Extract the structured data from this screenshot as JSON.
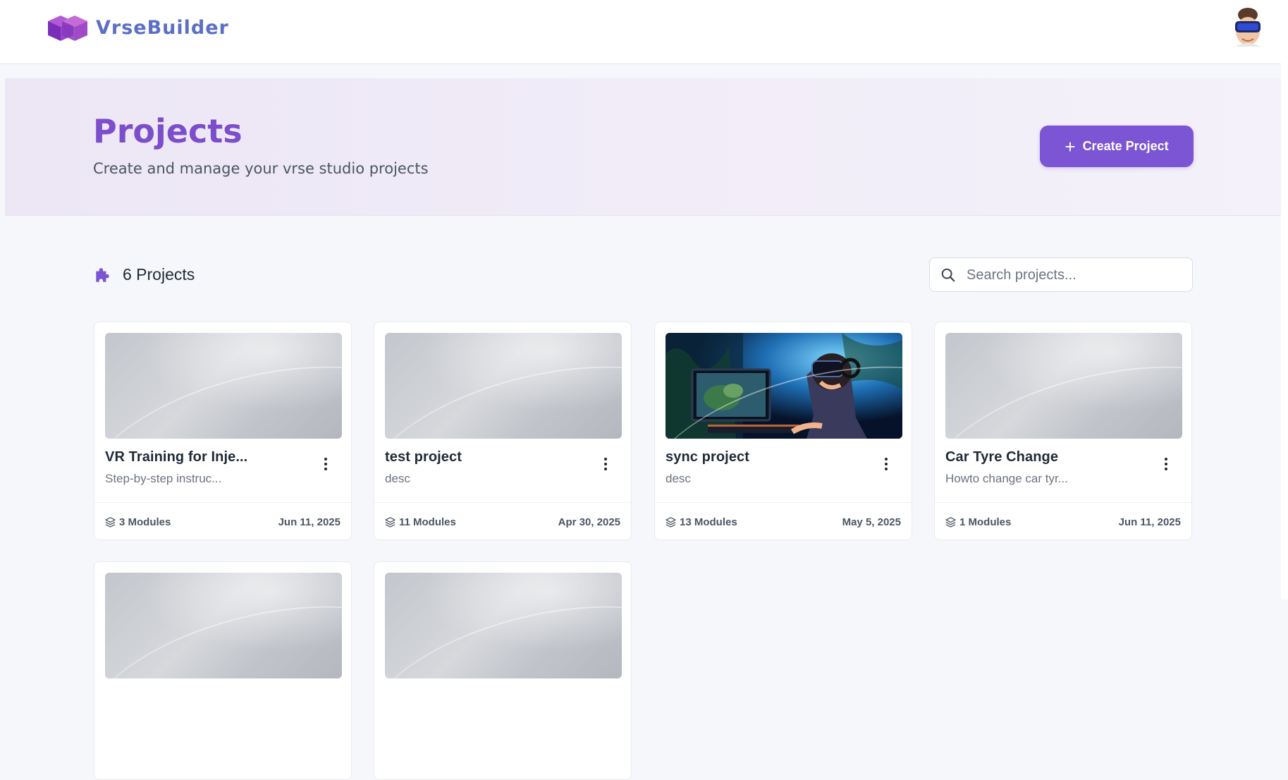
{
  "header": {
    "brand_name": "VrseBuilder"
  },
  "hero": {
    "title": "Projects",
    "subtitle": "Create and manage your vrse studio projects",
    "create_button_label": "Create Project"
  },
  "toolbar": {
    "project_count_label": "6 Projects",
    "search_placeholder": "Search projects..."
  },
  "projects": [
    {
      "title": "VR Training for Inje...",
      "description": "Step-by-step instruc...",
      "modules": "3 Modules",
      "date": "Jun 11, 2025",
      "thumbnail": "placeholder"
    },
    {
      "title": "test project",
      "description": "desc",
      "modules": "11 Modules",
      "date": "Apr 30, 2025",
      "thumbnail": "placeholder"
    },
    {
      "title": "sync project",
      "description": "desc",
      "modules": "13 Modules",
      "date": "May 5, 2025",
      "thumbnail": "vr-gamer-image"
    },
    {
      "title": "Car Tyre Change",
      "description": "Howto change car tyr...",
      "modules": "1 Modules",
      "date": "Jun 11, 2025",
      "thumbnail": "placeholder"
    },
    {
      "thumbnail": "placeholder"
    },
    {
      "thumbnail": "placeholder"
    }
  ],
  "colors": {
    "accent": "#7c55d4",
    "title_purple": "#7c4ecb",
    "brand_blue": "#5b6fc6"
  }
}
